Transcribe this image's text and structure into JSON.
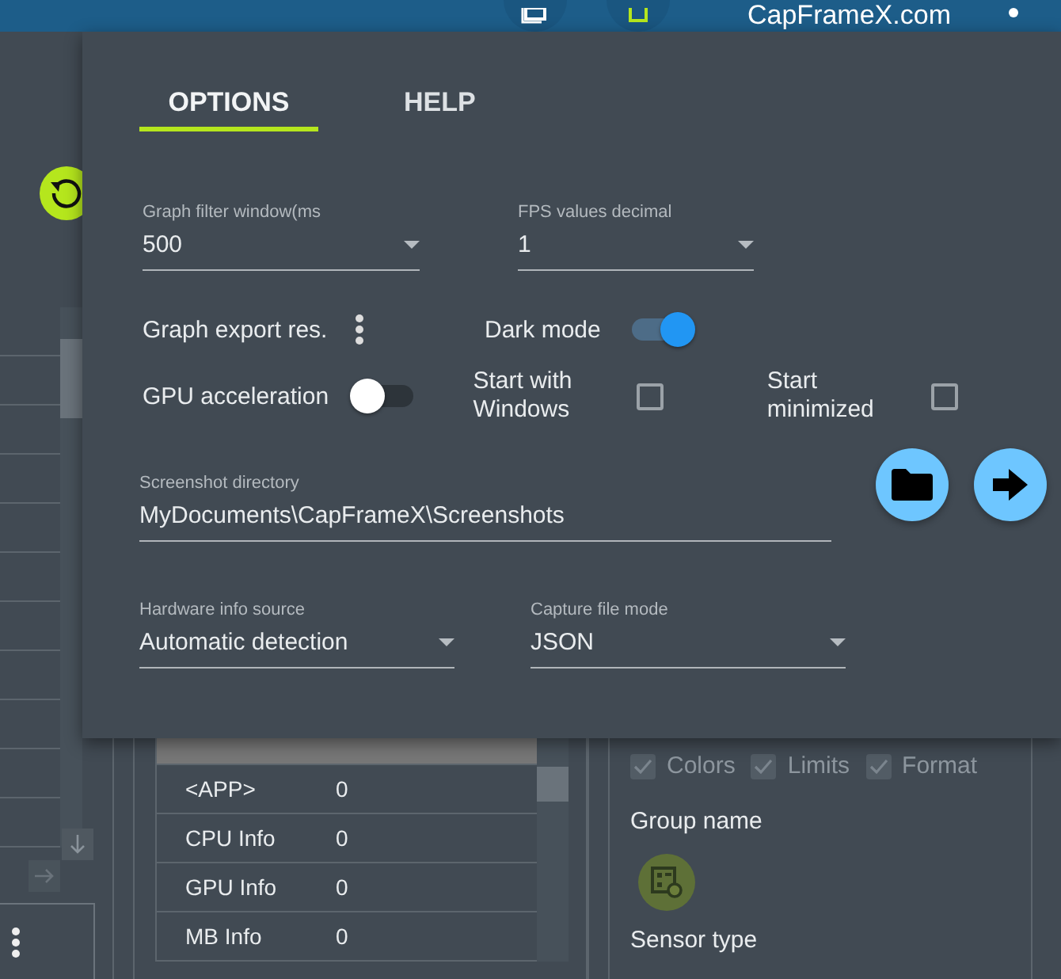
{
  "top_bar": {
    "site_link": "CapFrameX.com"
  },
  "sensor_table": {
    "rows": [
      {
        "selected": true
      },
      {
        "name": "<APP>",
        "value": "0",
        "selected": false
      },
      {
        "name": "CPU Info",
        "value": "0",
        "selected": false
      },
      {
        "name": "GPU Info",
        "value": "0",
        "selected": false
      },
      {
        "name": "MB Info",
        "value": "0",
        "selected": false
      }
    ]
  },
  "export_options": [
    {
      "label": "Colors",
      "checked": true,
      "disabled": true
    },
    {
      "label": "Limits",
      "checked": true,
      "disabled": true
    },
    {
      "label": "Format",
      "checked": true,
      "disabled": true
    }
  ],
  "group_name_label": "Group name",
  "sensor_type_label": "Sensor type",
  "options_popup": {
    "tabs": [
      {
        "label": "OPTIONS",
        "selected": true
      },
      {
        "label": "HELP",
        "selected": false
      }
    ],
    "rows": [
      [
        {
          "kind": "select",
          "label": "Graph filter window(ms",
          "value": "500"
        },
        {
          "kind": "select",
          "label": "FPS values decimal",
          "value": "1"
        }
      ],
      [
        {
          "kind": "menu",
          "label": "Graph export res."
        },
        {
          "kind": "toggle",
          "label": "Dark mode",
          "on": true
        }
      ],
      [
        {
          "kind": "toggle",
          "label": "GPU acceleration",
          "on": false
        },
        {
          "kind": "checkbox",
          "label": "Start with Windows",
          "checked": false
        },
        {
          "kind": "checkbox",
          "label": "Start minimized",
          "checked": false
        }
      ],
      [
        {
          "kind": "path",
          "label": "Screenshot directory",
          "value": "MyDocuments\\CapFrameX\\Screenshots"
        }
      ],
      [
        {
          "kind": "select",
          "label": "Hardware info source",
          "value": "Automatic detection"
        },
        {
          "kind": "select",
          "label": "Capture file mode",
          "value": "JSON"
        }
      ]
    ]
  }
}
